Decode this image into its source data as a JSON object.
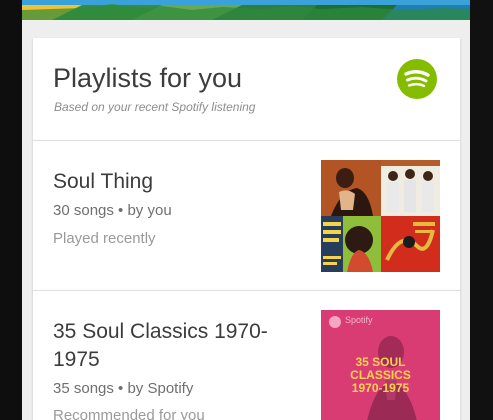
{
  "card": {
    "title": "Playlists for you",
    "subtitle": "Based on your recent Spotify listening",
    "brand_icon": "spotify-logo-icon",
    "brand_color": "#84bd00"
  },
  "playlists": [
    {
      "name": "Soul Thing",
      "meta": "30 songs • by you",
      "status": "Played recently",
      "cover": "album-collage-image"
    },
    {
      "name": "35 Soul Classics 1970-1975",
      "meta": "35 songs • by Spotify",
      "status": "Recommended for you",
      "cover": "spotify-playlist-cover-image",
      "cover_brand": "Spotify",
      "cover_text_line1": "35 SOUL",
      "cover_text_line2": "CLASSICS",
      "cover_text_line3": "1970-1975"
    }
  ],
  "colors": {
    "card_background": "#ffffff",
    "screen_background": "#eeeeee",
    "title_text": "#3c3c3c",
    "secondary_text": "#6f6f6f",
    "tertiary_text": "#9a9a9a",
    "cover2_background": "#d93c73"
  }
}
